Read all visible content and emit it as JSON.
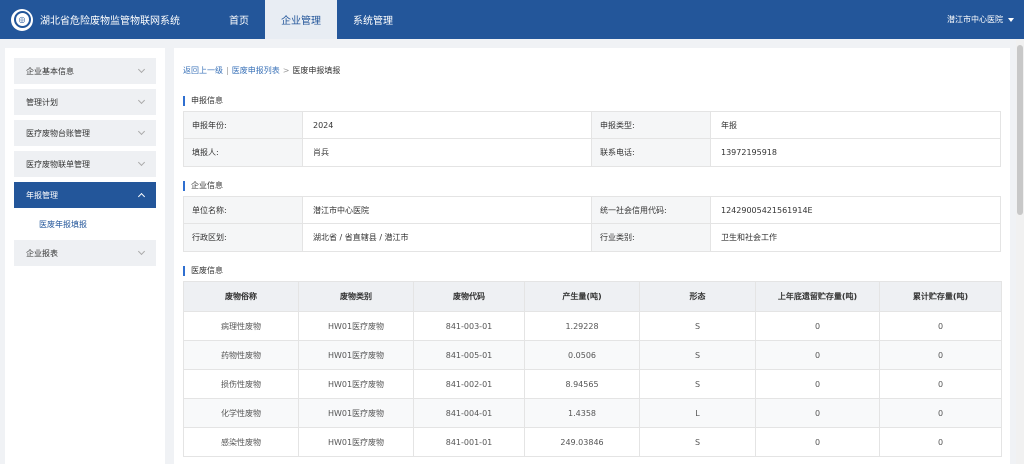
{
  "header": {
    "app_title": "湖北省危险废物监管物联网系统",
    "nav": [
      "首页",
      "企业管理",
      "系统管理"
    ],
    "active_nav": 1,
    "user": "潜江市中心医院"
  },
  "sidebar": {
    "items": [
      {
        "label": "企业基本信息"
      },
      {
        "label": "管理计划"
      },
      {
        "label": "医疗废物台账管理"
      },
      {
        "label": "医疗废物联单管理"
      },
      {
        "label": "年报管理"
      },
      {
        "label": "企业报表"
      }
    ],
    "active_item": 4,
    "submenu": {
      "label": "医废年报填报"
    }
  },
  "breadcrumb": {
    "back": "返回上一级",
    "sep": "|",
    "list": "医废申报列表",
    "arrow": ">",
    "current": "医废申报填报"
  },
  "report_info": {
    "title": "申报信息",
    "rows": [
      {
        "label1": "申报年份:",
        "value1": "2024",
        "label2": "申报类型:",
        "value2": "年报"
      },
      {
        "label1": "填报人:",
        "value1": "肖兵",
        "label2": "联系电话:",
        "value2": "13972195918"
      }
    ]
  },
  "company_info": {
    "title": "企业信息",
    "rows": [
      {
        "label1": "单位名称:",
        "value1": "潜江市中心医院",
        "label2": "统一社会信用代码:",
        "value2": "12429005421561914E"
      },
      {
        "label1": "行政区划:",
        "value1": "湖北省 / 省直辖县 / 潜江市",
        "label2": "行业类别:",
        "value2": "卫生和社会工作"
      }
    ]
  },
  "waste_info": {
    "title": "医废信息",
    "columns": [
      "废物俗称",
      "废物类别",
      "废物代码",
      "产生量(吨)",
      "形态",
      "上年底遗留贮存量(吨)",
      "累计贮存量(吨)"
    ],
    "rows": [
      [
        "病理性废物",
        "HW01医疗废物",
        "841-003-01",
        "1.29228",
        "S",
        "0",
        "0"
      ],
      [
        "药物性废物",
        "HW01医疗废物",
        "841-005-01",
        "0.0506",
        "S",
        "0",
        "0"
      ],
      [
        "损伤性废物",
        "HW01医疗废物",
        "841-002-01",
        "8.94565",
        "S",
        "0",
        "0"
      ],
      [
        "化学性废物",
        "HW01医疗废物",
        "841-004-01",
        "1.4358",
        "L",
        "0",
        "0"
      ],
      [
        "感染性废物",
        "HW01医疗废物",
        "841-001-01",
        "249.03846",
        "S",
        "0",
        "0"
      ]
    ]
  }
}
